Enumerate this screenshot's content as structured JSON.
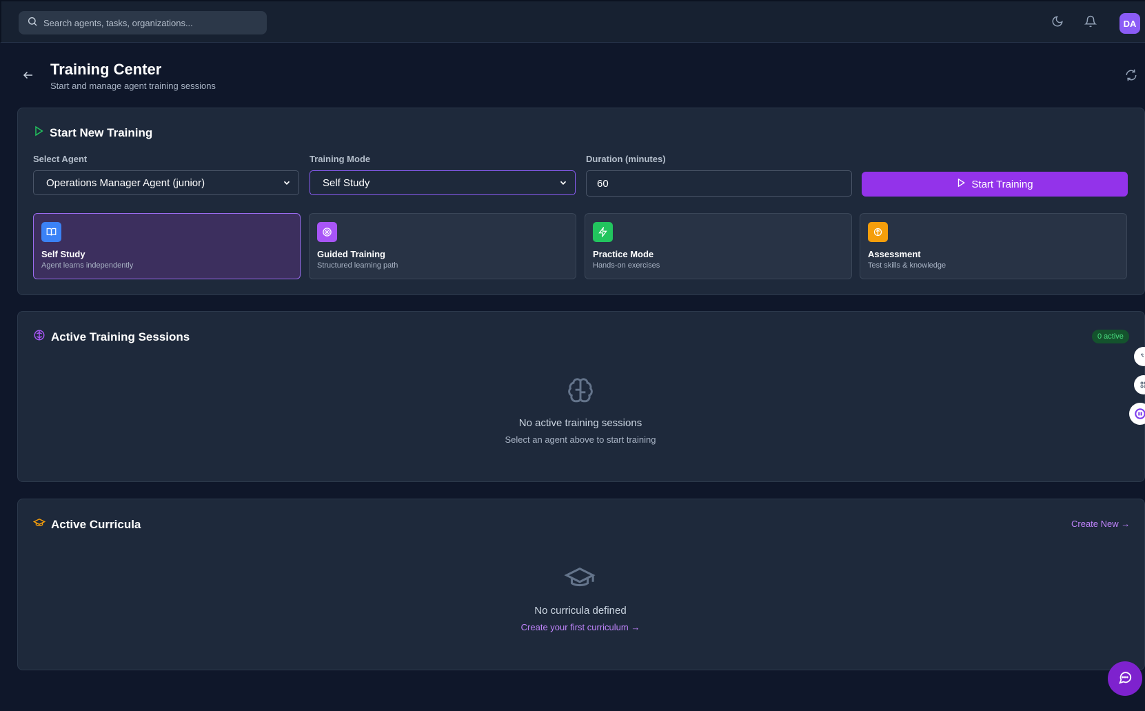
{
  "topbar": {
    "search_placeholder": "Search agents, tasks, organizations...",
    "avatar_initials": "DA"
  },
  "page": {
    "title": "Training Center",
    "subtitle": "Start and manage agent training sessions"
  },
  "start_training": {
    "title": "Start New Training",
    "agent_label": "Select Agent",
    "agent_value": "Operations Manager Agent (junior)",
    "mode_label": "Training Mode",
    "mode_value": "Self Study",
    "duration_label": "Duration (minutes)",
    "duration_value": "60",
    "start_button": "Start Training",
    "modes": [
      {
        "name": "Self Study",
        "desc": "Agent learns independently",
        "color": "#3b82f6",
        "icon": "book-icon"
      },
      {
        "name": "Guided Training",
        "desc": "Structured learning path",
        "color": "#a855f7",
        "icon": "target-icon"
      },
      {
        "name": "Practice Mode",
        "desc": "Hands-on exercises",
        "color": "#22c55e",
        "icon": "bolt-icon"
      },
      {
        "name": "Assessment",
        "desc": "Test skills & knowledge",
        "color": "#f59e0b",
        "icon": "brain-icon"
      }
    ]
  },
  "sessions": {
    "title": "Active Training Sessions",
    "badge": "0 active",
    "empty_title": "No active training sessions",
    "empty_sub": "Select an agent above to start training"
  },
  "curricula": {
    "title": "Active Curricula",
    "create_link": "Create New →",
    "empty_title": "No curricula defined",
    "empty_link": "Create your first curriculum →"
  },
  "colors": {
    "background": "#0f172a",
    "card": "#1e293b",
    "accent": "#9333ea",
    "success": "#4ade80"
  }
}
